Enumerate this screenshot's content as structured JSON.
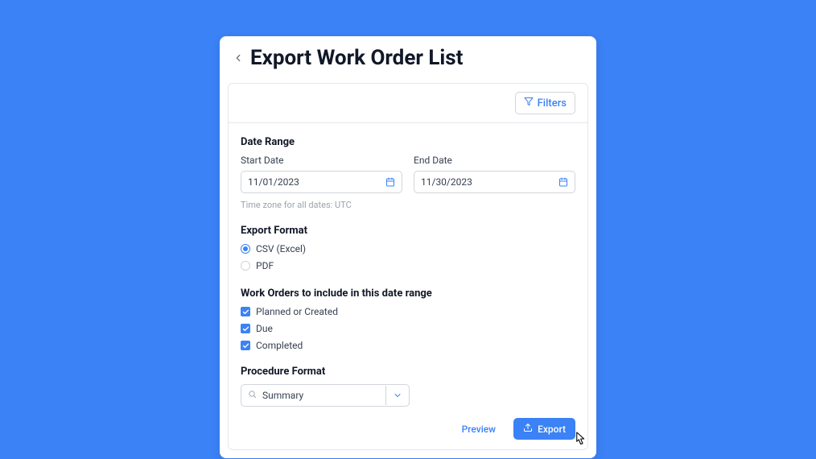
{
  "header": {
    "title": "Export Work Order List"
  },
  "filters": {
    "label": "Filters"
  },
  "dateRange": {
    "heading": "Date Range",
    "start": {
      "label": "Start Date",
      "value": "11/01/2023"
    },
    "end": {
      "label": "End Date",
      "value": "11/30/2023"
    },
    "helper": "Time zone for all dates: UTC"
  },
  "exportFormat": {
    "heading": "Export Format",
    "options": {
      "csv": "CSV (Excel)",
      "pdf": "PDF"
    }
  },
  "workOrders": {
    "heading": "Work Orders to include in this date range",
    "planned": "Planned or Created",
    "due": "Due",
    "completed": "Completed"
  },
  "procedure": {
    "heading": "Procedure Format",
    "selected": "Summary"
  },
  "actions": {
    "preview": "Preview",
    "export": "Export"
  }
}
